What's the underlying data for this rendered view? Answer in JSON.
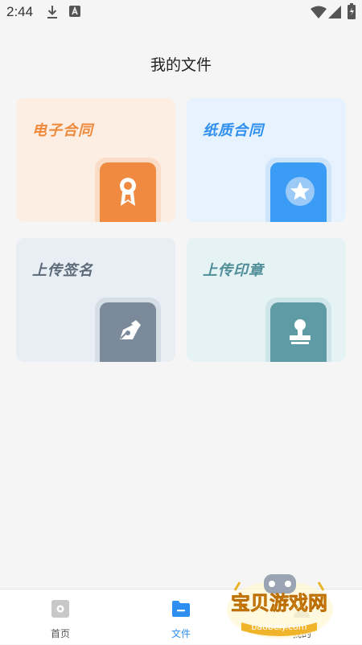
{
  "status_bar": {
    "time": "2:44",
    "icons": [
      "download-icon",
      "text-icon",
      "wifi-icon",
      "battery-icon"
    ]
  },
  "page": {
    "title": "我的文件"
  },
  "cards": [
    {
      "label": "电子合同",
      "icon": "ribbon-award-icon",
      "label_color": "#ee8a3c",
      "bg": "#fdeee4",
      "badge_color": "#ef8a40"
    },
    {
      "label": "纸质合同",
      "icon": "star-badge-icon",
      "label_color": "#2e8ff0",
      "bg": "#e6f2fd",
      "badge_color": "#3a9cf5"
    },
    {
      "label": "上传签名",
      "icon": "pen-sign-icon",
      "label_color": "#5b6978",
      "bg": "#e8eef4",
      "badge_color": "#7b8a9a"
    },
    {
      "label": "上传印章",
      "icon": "stamp-icon",
      "label_color": "#4f8e98",
      "bg": "#e6f3f5",
      "badge_color": "#5f9ba5"
    }
  ],
  "tabbar": {
    "active_color": "#2e8ff0",
    "tabs": [
      {
        "label": "首页",
        "icon": "home-icon",
        "active": false
      },
      {
        "label": "文件",
        "icon": "folder-icon",
        "active": true
      },
      {
        "label": "我的",
        "icon": "profile-icon",
        "active": false
      }
    ]
  },
  "watermark": {
    "brand": "宝贝游戏网",
    "url": "baobeiy.com"
  }
}
